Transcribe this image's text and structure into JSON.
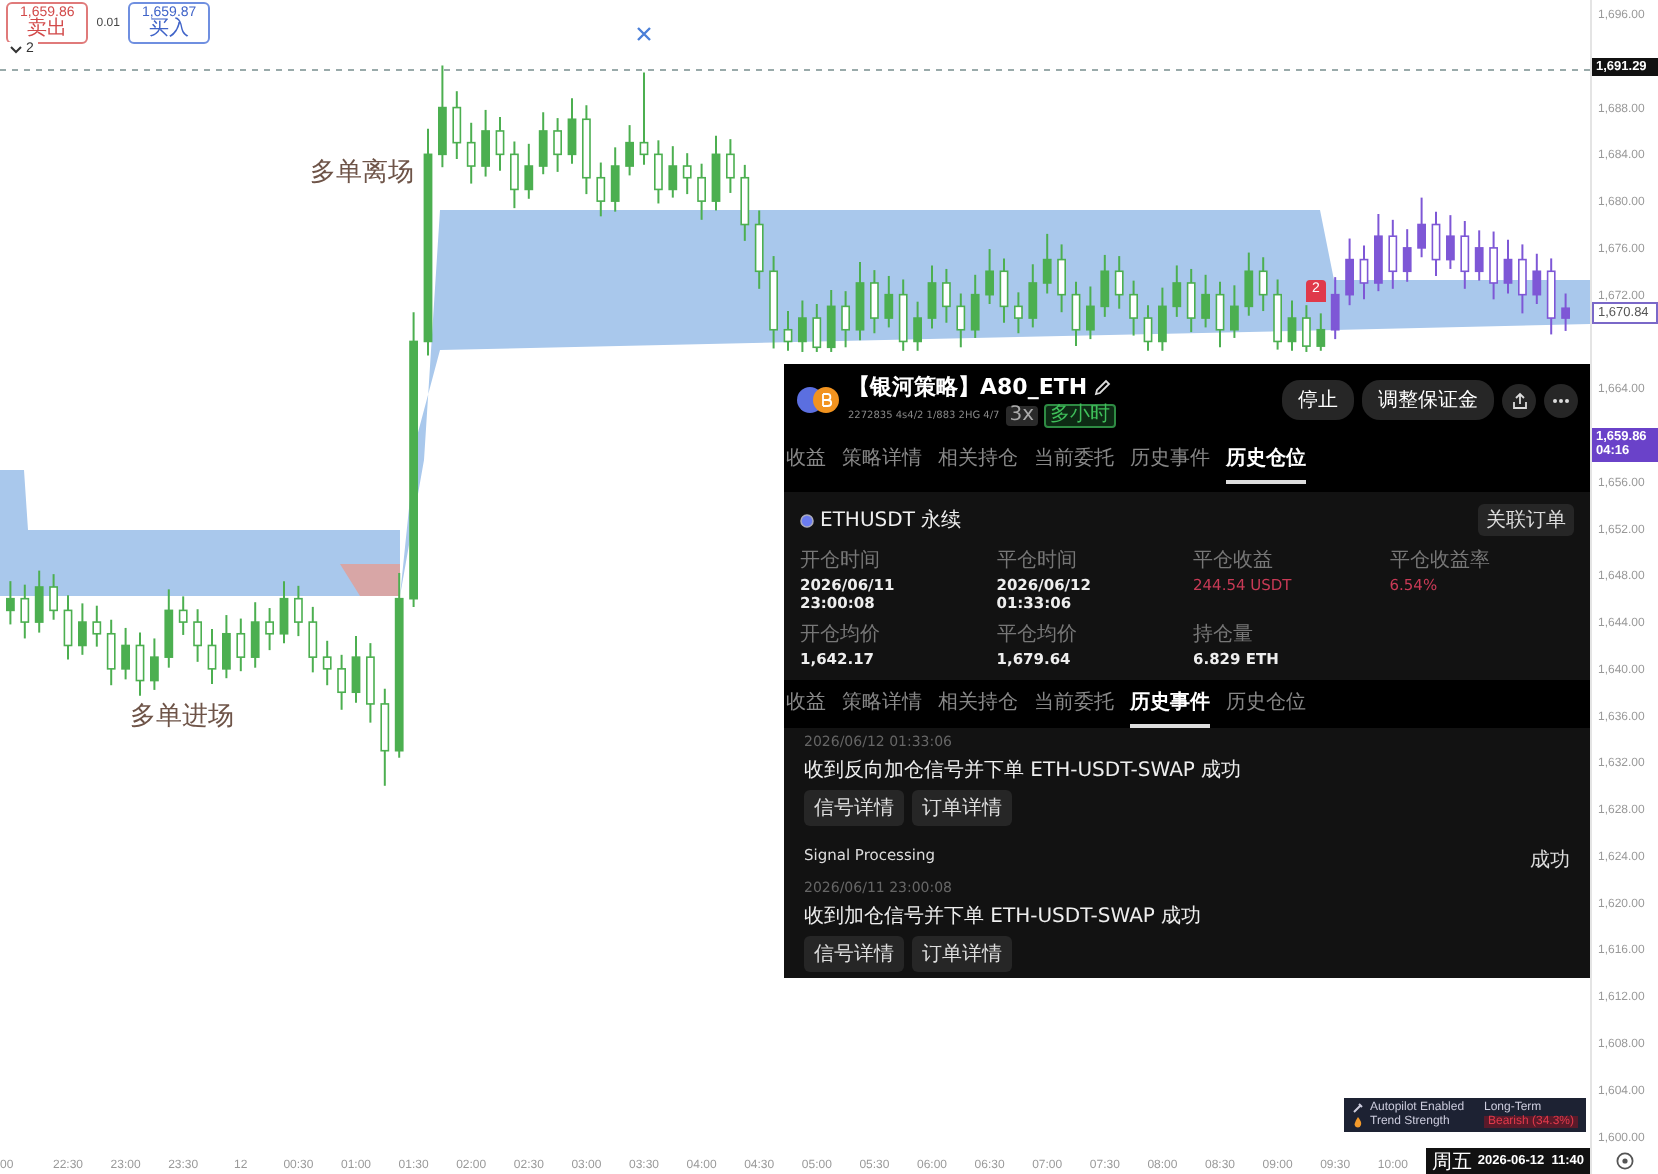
{
  "order_bar": {
    "sell": {
      "price": "1,659.86",
      "label": "卖出"
    },
    "spread": "0.01",
    "buy": {
      "price": "1,659.87",
      "label": "买入"
    },
    "collapse": {
      "count": "2"
    }
  },
  "chart": {
    "chart_data": {
      "type": "candlestick",
      "ylim": [
        1596.8,
        1697.2
      ],
      "yticks": [
        {
          "value": 1696,
          "label": "1,696.00"
        },
        {
          "value": 1688,
          "label": "1,688.00"
        },
        {
          "value": 1684,
          "label": "1,684.00"
        },
        {
          "value": 1680,
          "label": "1,680.00"
        },
        {
          "value": 1676,
          "label": "1,676.00"
        },
        {
          "value": 1672,
          "label": "1,672.00"
        },
        {
          "value": 1664,
          "label": "1,664.00"
        },
        {
          "value": 1656,
          "label": "1,656.00"
        },
        {
          "value": 1652,
          "label": "1,652.00"
        },
        {
          "value": 1648,
          "label": "1,648.00"
        },
        {
          "value": 1644,
          "label": "1,644.00"
        },
        {
          "value": 1640,
          "label": "1,640.00"
        },
        {
          "value": 1636,
          "label": "1,636.00"
        },
        {
          "value": 1632,
          "label": "1,632.00"
        },
        {
          "value": 1628,
          "label": "1,628.00"
        },
        {
          "value": 1624,
          "label": "1,624.00"
        },
        {
          "value": 1620,
          "label": "1,620.00"
        },
        {
          "value": 1616,
          "label": "1,616.00"
        },
        {
          "value": 1612,
          "label": "1,612.00"
        },
        {
          "value": 1608,
          "label": "1,608.00"
        },
        {
          "value": 1604,
          "label": "1,604.00"
        },
        {
          "value": 1600,
          "label": "1,600.00"
        }
      ],
      "categories": [
        "00",
        null,
        null,
        null,
        "22:30",
        null,
        null,
        null,
        "23:00",
        null,
        null,
        null,
        "23:30",
        null,
        null,
        null,
        "12",
        null,
        null,
        null,
        "00:30",
        null,
        null,
        null,
        "01:00",
        null,
        null,
        null,
        "01:30",
        null,
        null,
        null,
        "02:00",
        null,
        null,
        null,
        "02:30",
        null,
        null,
        null,
        "03:00",
        null,
        null,
        null,
        "03:30",
        null,
        null,
        null,
        "04:00",
        null,
        null,
        null,
        "04:30",
        null,
        null,
        null,
        "05:00",
        null,
        null,
        null,
        "05:30",
        null,
        null,
        null,
        "06:00",
        null,
        null,
        null,
        "06:30",
        null,
        null,
        null,
        "07:00",
        null,
        null,
        null,
        "07:30",
        null,
        null,
        null,
        "08:00",
        null,
        null,
        null,
        "08:30",
        null,
        null,
        null,
        "09:00",
        null,
        null,
        null,
        "09:30",
        null,
        null,
        null,
        "10:00",
        null,
        null,
        null,
        null,
        null,
        null,
        null,
        null,
        null,
        null,
        null,
        null
      ],
      "series": [
        {
          "color": "#4caf50",
          "ohlc": [
            [
              1645,
              1647.5,
              1643.8,
              1646
            ],
            [
              1646,
              1647.2,
              1642.6,
              1644
            ],
            [
              1644,
              1648.4,
              1643.1,
              1647
            ],
            [
              1647,
              1648.1,
              1644.2,
              1645
            ],
            [
              1645,
              1646.3,
              1640.8,
              1642
            ],
            [
              1642,
              1645.6,
              1641.2,
              1644
            ],
            [
              1644,
              1645.4,
              1641.9,
              1643
            ],
            [
              1643,
              1644.2,
              1638.6,
              1640
            ],
            [
              1640,
              1643.5,
              1639.1,
              1642
            ],
            [
              1642,
              1643.1,
              1637.7,
              1639
            ],
            [
              1639,
              1642.6,
              1638.2,
              1641
            ],
            [
              1641,
              1646.8,
              1640.1,
              1645
            ],
            [
              1645,
              1646.2,
              1642.9,
              1644
            ],
            [
              1644,
              1645.1,
              1640.6,
              1642
            ],
            [
              1642,
              1643.4,
              1638.7,
              1640
            ],
            [
              1640,
              1644.6,
              1639.2,
              1643
            ],
            [
              1643,
              1644.3,
              1639.8,
              1641
            ],
            [
              1641,
              1645.7,
              1640.1,
              1644
            ],
            [
              1644,
              1645.2,
              1641.6,
              1643
            ],
            [
              1643,
              1647.5,
              1642.2,
              1646
            ],
            [
              1646,
              1647.1,
              1642.8,
              1644
            ],
            [
              1644,
              1645.3,
              1639.7,
              1641
            ],
            [
              1641,
              1642.4,
              1638.6,
              1640
            ],
            [
              1640,
              1641.2,
              1636.5,
              1638
            ],
            [
              1638,
              1642.8,
              1637.1,
              1641
            ],
            [
              1641,
              1642.2,
              1635.4,
              1637
            ],
            [
              1637,
              1638.3,
              1630,
              1633
            ],
            [
              1633,
              1648.2,
              1632.4,
              1646
            ],
            [
              1646,
              1670.5,
              1645.3,
              1668
            ],
            [
              1668,
              1686.2,
              1666.8,
              1684
            ],
            [
              1684,
              1691.6,
              1682.9,
              1688
            ],
            [
              1688,
              1689.4,
              1683.6,
              1685
            ],
            [
              1685,
              1686.7,
              1681.5,
              1683
            ],
            [
              1683,
              1687.8,
              1682.1,
              1686
            ],
            [
              1686,
              1687.2,
              1682.6,
              1684
            ],
            [
              1684,
              1685.1,
              1679.4,
              1681
            ],
            [
              1681,
              1684.9,
              1680.2,
              1683
            ],
            [
              1683,
              1687.6,
              1682.3,
              1686
            ],
            [
              1686,
              1687.1,
              1682.5,
              1684
            ],
            [
              1684,
              1688.8,
              1683.2,
              1687
            ],
            [
              1687,
              1688.2,
              1680.6,
              1682
            ],
            [
              1682,
              1683.3,
              1678.7,
              1680
            ],
            [
              1680,
              1684.6,
              1679.1,
              1683
            ],
            [
              1683,
              1686.5,
              1682.2,
              1685
            ],
            [
              1685,
              1691,
              1683.1,
              1684
            ],
            [
              1684,
              1685.2,
              1679.8,
              1681
            ],
            [
              1681,
              1684.7,
              1680.3,
              1683
            ],
            [
              1683,
              1684.1,
              1680.6,
              1682
            ],
            [
              1682,
              1683.2,
              1678.4,
              1680
            ],
            [
              1680,
              1685.6,
              1679.2,
              1684
            ],
            [
              1684,
              1685.3,
              1680.7,
              1682
            ],
            [
              1682,
              1683.1,
              1676.6,
              1678
            ],
            [
              1678,
              1679.2,
              1672.5,
              1674
            ],
            [
              1674,
              1675.3,
              1667.4,
              1669
            ],
            [
              1669,
              1670.6,
              1667.2,
              1668
            ],
            [
              1668,
              1671.5,
              1667.1,
              1670
            ],
            [
              1670,
              1671.2,
              1667.1,
              1667.5
            ],
            [
              1667.5,
              1672.4,
              1667.1,
              1671
            ],
            [
              1671,
              1672.3,
              1667.5,
              1669
            ],
            [
              1669,
              1674.8,
              1668.1,
              1673
            ],
            [
              1673,
              1674.1,
              1668.7,
              1670
            ],
            [
              1670,
              1673.6,
              1669.2,
              1672
            ],
            [
              1672,
              1673.3,
              1667.2,
              1668
            ],
            [
              1668,
              1671.4,
              1667.2,
              1670
            ],
            [
              1670,
              1674.5,
              1669.1,
              1673
            ],
            [
              1673,
              1674.2,
              1669.6,
              1671
            ],
            [
              1671,
              1672.1,
              1667.5,
              1669
            ],
            [
              1669,
              1673.7,
              1668.3,
              1672
            ],
            [
              1672,
              1675.9,
              1671.2,
              1674
            ],
            [
              1674,
              1675.1,
              1669.6,
              1671
            ],
            [
              1671,
              1672.2,
              1668.7,
              1670
            ],
            [
              1670,
              1674.6,
              1669.2,
              1673
            ],
            [
              1673,
              1677.2,
              1672.1,
              1675
            ],
            [
              1675,
              1676.3,
              1670.5,
              1672
            ],
            [
              1672,
              1673.1,
              1667.6,
              1669
            ],
            [
              1669,
              1672.7,
              1668.2,
              1671
            ],
            [
              1671,
              1675.4,
              1670.1,
              1674
            ],
            [
              1674,
              1675.3,
              1670.8,
              1672
            ],
            [
              1672,
              1673.2,
              1668.5,
              1670
            ],
            [
              1670,
              1671.1,
              1667.2,
              1668
            ],
            [
              1668,
              1672.6,
              1667.2,
              1671
            ],
            [
              1671,
              1674.5,
              1670.1,
              1673
            ],
            [
              1673,
              1674.2,
              1668.8,
              1670
            ],
            [
              1670,
              1673.7,
              1669.2,
              1672
            ],
            [
              1672,
              1673.1,
              1667.5,
              1669
            ],
            [
              1669,
              1672.8,
              1668.3,
              1671
            ],
            [
              1671,
              1675.6,
              1670.2,
              1674
            ],
            [
              1674,
              1675.2,
              1670.6,
              1672
            ],
            [
              1672,
              1673.3,
              1667.3,
              1668
            ],
            [
              1668,
              1671.5,
              1667.2,
              1670
            ],
            [
              1670,
              1671.1,
              1667.1,
              1667.6
            ],
            [
              1667.6,
              1670.4,
              1667.2,
              1669
            ],
            null,
            null,
            null,
            null,
            null,
            null,
            null,
            null,
            null,
            null,
            null,
            null,
            null,
            null,
            null,
            null,
            null
          ]
        },
        {
          "color": "#7e57d6",
          "ohlc": [
            null,
            null,
            null,
            null,
            null,
            null,
            null,
            null,
            null,
            null,
            null,
            null,
            null,
            null,
            null,
            null,
            null,
            null,
            null,
            null,
            null,
            null,
            null,
            null,
            null,
            null,
            null,
            null,
            null,
            null,
            null,
            null,
            null,
            null,
            null,
            null,
            null,
            null,
            null,
            null,
            null,
            null,
            null,
            null,
            null,
            null,
            null,
            null,
            null,
            null,
            null,
            null,
            null,
            null,
            null,
            null,
            null,
            null,
            null,
            null,
            null,
            null,
            null,
            null,
            null,
            null,
            null,
            null,
            null,
            null,
            null,
            null,
            null,
            null,
            null,
            null,
            null,
            null,
            null,
            null,
            null,
            null,
            null,
            null,
            null,
            null,
            null,
            null,
            null,
            null,
            null,
            null,
            [
              1669,
              1673.5,
              1668.2,
              1672
            ],
            [
              1672,
              1676.8,
              1671.1,
              1675
            ],
            [
              1675,
              1676.2,
              1671.6,
              1673
            ],
            [
              1673,
              1678.9,
              1672.3,
              1677
            ],
            [
              1677,
              1678.4,
              1672.5,
              1674
            ],
            [
              1674,
              1677.6,
              1673.1,
              1676
            ],
            [
              1676,
              1680.3,
              1675.2,
              1678
            ],
            [
              1678,
              1679.1,
              1673.6,
              1675
            ],
            [
              1675,
              1678.8,
              1674.2,
              1677
            ],
            [
              1677,
              1678.3,
              1672.5,
              1674
            ],
            [
              1674,
              1677.5,
              1673.2,
              1676
            ],
            [
              1676,
              1677.4,
              1671.6,
              1673
            ],
            [
              1673,
              1676.7,
              1672.1,
              1675
            ],
            [
              1675,
              1676.3,
              1670.4,
              1672
            ],
            [
              1672,
              1675.5,
              1671.2,
              1674
            ],
            [
              1674,
              1675.1,
              1668.6,
              1670
            ],
            [
              1670,
              1672.1,
              1668.9,
              1670.84
            ]
          ]
        }
      ]
    }
  },
  "annotations": [
    {
      "text": "多单离场"
    },
    {
      "text": "多单进场"
    }
  ],
  "flag": {
    "text": "2"
  },
  "panel": {
    "title": "【银河策略】A80_ETH",
    "subtitle": "2272835 4s4/2 1/883 2HG 4/7",
    "badges": [
      {
        "text": "3x",
        "kind": "plain"
      },
      {
        "text": "多小时",
        "kind": "green"
      }
    ],
    "buttons": [
      "停止",
      "调整保证金"
    ],
    "tabs": [
      {
        "label": "收益",
        "selected": false
      },
      {
        "label": "策略详情",
        "selected": false
      },
      {
        "label": "相关持仓",
        "selected": false
      },
      {
        "label": "当前委托",
        "selected": false
      },
      {
        "label": "历史事件",
        "selected": false
      },
      {
        "label": "历史仓位",
        "selected": true
      }
    ],
    "position": {
      "symbol": "ETHUSDT 永续",
      "link": "关联订单",
      "fields": [
        {
          "label": "开仓时间",
          "value": "2026/06/11 23:00:08",
          "kind": "plain"
        },
        {
          "label": "平仓时间",
          "value": "2026/06/12 01:33:06",
          "kind": "plain"
        },
        {
          "label": "平仓收益",
          "value": "244.54 USDT",
          "kind": "loss"
        },
        {
          "label": "平仓收益率",
          "value": "6.54%",
          "kind": "loss"
        },
        {
          "label": "开仓均价",
          "value": "1,642.17",
          "kind": "plain"
        },
        {
          "label": "平仓均价",
          "value": "1,679.64",
          "kind": "plain"
        },
        {
          "label": "持仓量",
          "value": "6.829 ETH",
          "kind": "plain"
        }
      ]
    },
    "tabs_2": [
      {
        "label": "收益",
        "selected": false
      },
      {
        "label": "策略详情",
        "selected": false
      },
      {
        "label": "相关持仓",
        "selected": false
      },
      {
        "label": "当前委托",
        "selected": false
      },
      {
        "label": "历史事件",
        "selected": true
      },
      {
        "label": "历史仓位",
        "selected": false
      }
    ],
    "events": [
      {
        "time": "2026/06/12 01:33:06",
        "message": "收到反向加仓信号并下单 ETH-USDT-SWAP 成功",
        "actions": [
          "信号详情",
          "订单详情"
        ]
      },
      {
        "title": "Signal Processing",
        "status": "成功",
        "time": "2026/06/11 23:00:08",
        "message": "收到加仓信号并下单 ETH-USDT-SWAP 成功",
        "actions": [
          "信号详情",
          "订单详情"
        ]
      }
    ]
  },
  "legend": [
    {
      "label": "Autopilot Enabled",
      "value": "Long-Term",
      "kind": "plain"
    },
    {
      "label": "Trend Strength",
      "value": "Bearish (34.3%)",
      "kind": "alert"
    }
  ],
  "price_axis": {
    "tags": [
      {
        "kind": "last",
        "text": "1,691.29"
      },
      {
        "kind": "outline",
        "text": "1,670.84"
      },
      {
        "kind": "current",
        "text": "1,659.86",
        "sub": "04:16"
      }
    ]
  },
  "time_axis": {
    "cursor": {
      "day": "周五",
      "datetime": "2026-06-12  11:40"
    }
  }
}
